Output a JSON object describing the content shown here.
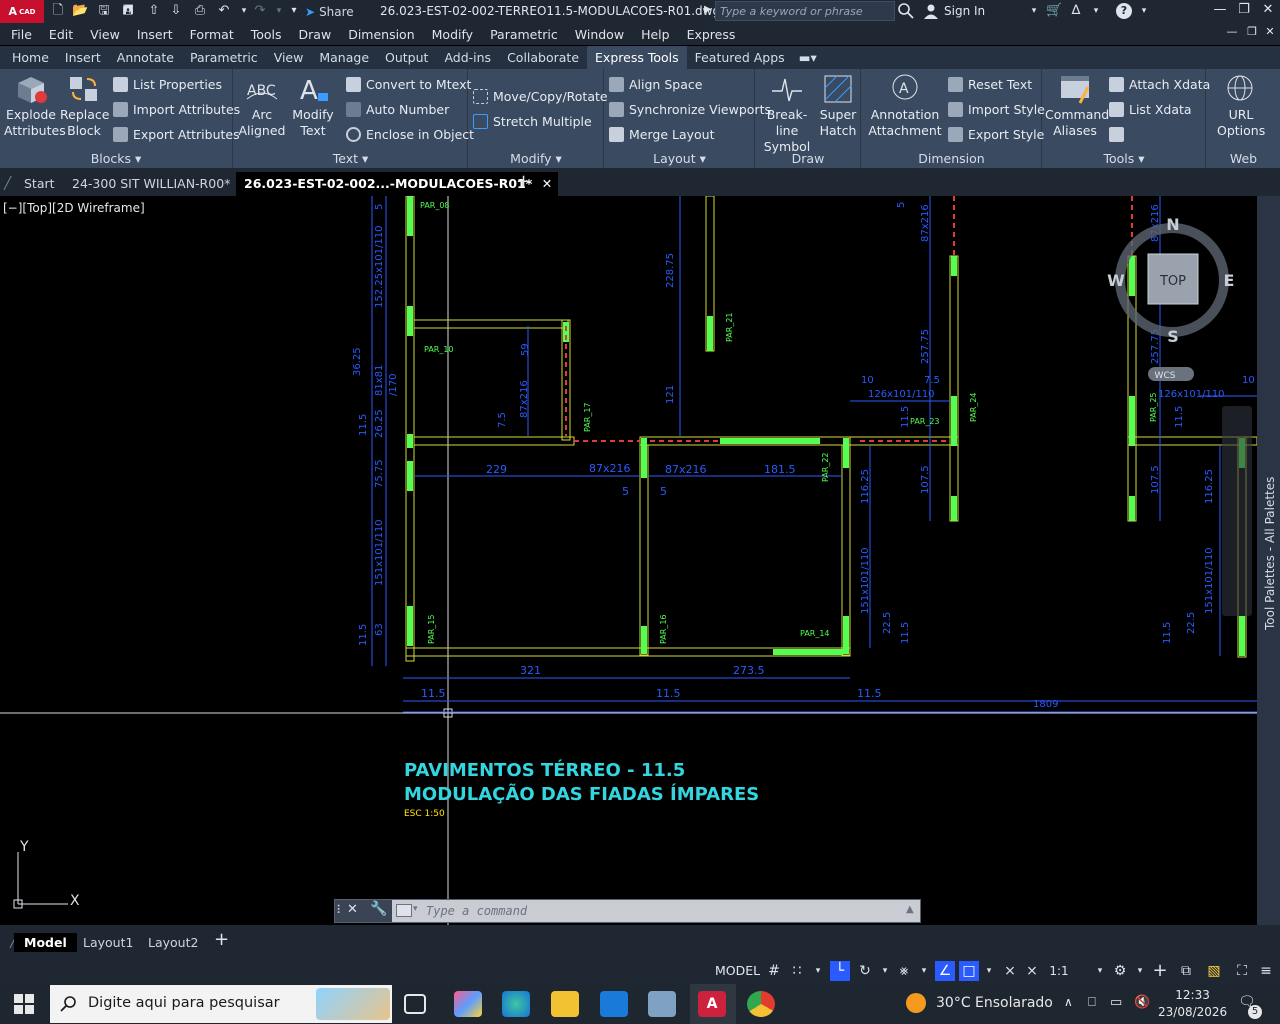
{
  "app": {
    "logo_text": "A",
    "logo_sub": "CAD",
    "share_label": "Share",
    "document_title": "26.023-EST-02-002-TERREO11.5-MODULACOES-R01.dwg",
    "search_placeholder": "Type a keyword or phrase",
    "sign_in": "Sign In"
  },
  "menu": [
    "File",
    "Edit",
    "View",
    "Insert",
    "Format",
    "Tools",
    "Draw",
    "Dimension",
    "Modify",
    "Parametric",
    "Window",
    "Help",
    "Express"
  ],
  "ribbon_tabs": [
    "Home",
    "Insert",
    "Annotate",
    "Parametric",
    "View",
    "Manage",
    "Output",
    "Add-ins",
    "Collaborate",
    "Express Tools",
    "Featured Apps"
  ],
  "ribbon_active_tab": "Express Tools",
  "ribbon": {
    "blocks": {
      "label": "Blocks",
      "explode_attributes": [
        "Explode",
        "Attributes"
      ],
      "replace_block": [
        "Replace",
        "Block"
      ],
      "list_properties": "List Properties",
      "import_attributes": "Import Attributes",
      "export_attributes": "Export Attributes"
    },
    "text": {
      "label": "Text",
      "arc_aligned": [
        "Arc",
        "Aligned"
      ],
      "modify_text": [
        "Modify",
        "Text"
      ],
      "convert_to_mtext": "Convert to Mtext",
      "auto_number": "Auto Number",
      "enclose_in_object": "Enclose in Object"
    },
    "modify": {
      "label": "Modify",
      "move_copy_rotate": "Move/Copy/Rotate",
      "stretch_multiple": "Stretch Multiple"
    },
    "layout": {
      "label": "Layout",
      "align_space": "Align Space",
      "synchronize_viewports": "Synchronize Viewports",
      "merge_layout": "Merge Layout"
    },
    "draw": {
      "label": "Draw",
      "break_line_symbol": [
        "Break-line",
        "Symbol"
      ],
      "super_hatch": [
        "Super",
        "Hatch"
      ]
    },
    "dimension": {
      "label": "Dimension",
      "annotation_attachment": [
        "Annotation",
        "Attachment"
      ],
      "reset_text": "Reset Text",
      "import_style": "Import Style",
      "export_style": "Export Style"
    },
    "tools": {
      "label": "Tools",
      "command_aliases": [
        "Command",
        "Aliases"
      ],
      "attach_xdata": "Attach Xdata",
      "list_xdata": "List Xdata"
    },
    "web": {
      "label": "Web",
      "url_options": [
        "URL",
        "Options"
      ]
    }
  },
  "file_tabs": [
    "Start",
    "24-300 SIT WILLIAN-R00*",
    "26.023-EST-02-002...-MODULACOES-R01*"
  ],
  "viewport": {
    "view_label": "[−][Top][2D Wireframe]",
    "viewcube": {
      "top": "TOP",
      "n": "N",
      "s": "S",
      "e": "E",
      "w": "W",
      "wcs": "WCS"
    },
    "caption_title": "PAVIMENTOS TÉRREO - 11.5",
    "caption_subtitle": "MODULAÇÃO DAS FIADAS ÍMPARES",
    "caption_scale": "ESC 1:50",
    "ucs": {
      "x": "X",
      "y": "Y"
    }
  },
  "drawing_labels": {
    "dims_blue": [
      "321",
      "273.5",
      "11.5",
      "11.5",
      "11.5",
      "1809",
      "229",
      "87x216",
      "87x216",
      "181.5",
      "5",
      "5",
      "10",
      "7.5",
      "10",
      "126x101/110",
      "126x101/110",
      "59",
      "87x216",
      "7.5",
      "121",
      "228.75",
      "257.75",
      "257.75",
      "87x216",
      "87x216",
      "152.25x101/110",
      "36.25",
      "81x81",
      "/170",
      "26.25",
      "11.5",
      "75.75",
      "151x101/110",
      "11.5",
      "63",
      "116.25",
      "151x101/110",
      "22.5",
      "11.5",
      "107.5",
      "107.5",
      "116.25",
      "151x101/110",
      "22.5",
      "11.5",
      "11.5",
      "11.5",
      "5",
      "5"
    ],
    "walls_green": [
      "PAR_08",
      "PAR_10",
      "PAR_17",
      "PAR_21",
      "PAR_23",
      "PAR_22",
      "PAR_24",
      "PAR_25",
      "PAR_15",
      "PAR_16",
      "PAR_14"
    ]
  },
  "palette_label": "Tool Palettes - All Palettes",
  "command_placeholder": "Type a command",
  "layout_tabs": [
    "Model",
    "Layout1",
    "Layout2"
  ],
  "status": {
    "model": "MODEL",
    "scale": "1:1"
  },
  "taskbar": {
    "search_placeholder": "Digite aqui para pesquisar",
    "weather": "30°C  Ensolarado",
    "time": "12:33",
    "date": "23/08/2026",
    "notifications": "5"
  },
  "colors": {
    "accent_red": "#c8102e",
    "ribbon_bg": "#3a4a60",
    "dim_blue": "#2a5bff",
    "wall_yellow": "#d8d83a",
    "wall_green": "#52ff52",
    "caption_cyan": "#33d6e0"
  }
}
